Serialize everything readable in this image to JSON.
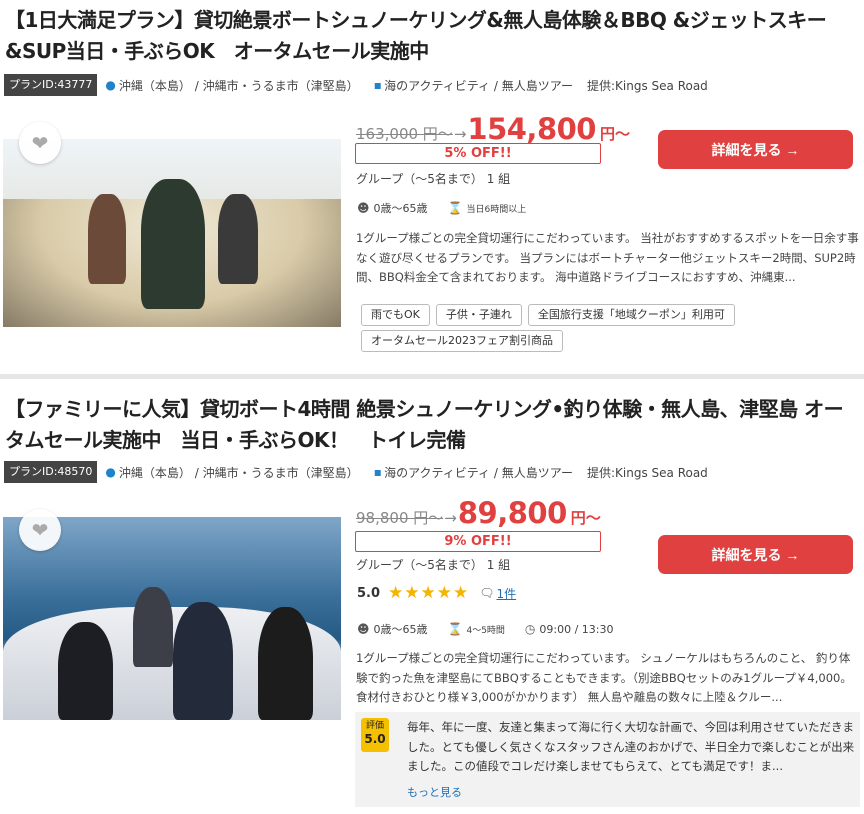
{
  "plans": [
    {
      "title": "【1日大満足プラン】貸切絶景ボートシュノーケリング&無人島体験＆BBQ &ジェットスキー&SUP当日・手ぶらOK　オータムセール実施中",
      "plan_id": "プランID:43777",
      "location": "沖縄（本島） / 沖縄市・うるま市（津堅島）",
      "category": "海のアクティビティ / 無人島ツアー",
      "provider": "提供:Kings Sea Road",
      "old_price": "163,000 円〜",
      "new_price": "154,800",
      "price_unit": "円〜",
      "discount": "5% OFF!!",
      "group": "グループ（〜5名まで） 1 組",
      "age": "0歳〜65歳",
      "duration": "当日6時間以上",
      "description": "1グループ様ごとの完全貸切運行にこだわっています。 当社がおすすめするスポットを一日余す事なく遊び尽くせるプランです。 当プランにはボートチャーター他ジェットスキー2時間、SUP2時間、BBQ料金全て含まれております。 海中道路ドライブコースにおすすめ、沖縄東...",
      "tags": [
        "雨でもOK",
        "子供・子連れ",
        "全国旅行支援「地域クーポン」利用可",
        "オータムセール2023フェア割引商品"
      ],
      "button": "詳細を見る →"
    },
    {
      "title": "【ファミリーに人気】貸切ボート4時間 絶景シュノーケリング•釣り体験・無人島、津堅島 オータムセール実施中　当日・手ぶらOK！　トイレ完備",
      "plan_id": "プランID:48570",
      "location": "沖縄（本島） / 沖縄市・うるま市（津堅島）",
      "category": "海のアクティビティ / 無人島ツアー",
      "provider": "提供:Kings Sea Road",
      "old_price": "98,800 円〜",
      "new_price": "89,800",
      "price_unit": "円〜",
      "discount": "9% OFF!!",
      "group": "グループ（〜5名まで） 1 組",
      "rating_score": "5.0",
      "stars": "★★★★★",
      "review_count": "1件",
      "age": "0歳〜65歳",
      "duration": "4〜5時間",
      "time": "09:00 / 13:30",
      "description": "1グループ様ごとの完全貸切運行にこだわっています。 シュノーケルはもちろんのこと、 釣り体験で釣った魚を津堅島にてBBQすることもできます。（別途BBQセットのみ1グループ￥4,000。食材付きおひとり様￥3,000がかかります） 無人島や離島の数々に上陸＆クルー...",
      "review_label": "評価",
      "review_score": "5.0",
      "review_text": "毎年、年に一度、友達と集まって海に行く大切な計画で、今回は利用させていただきました。とても優しく気さくなスタッフさん達のおかげで、半日全力で楽しむことが出来ました。この値段でコレだけ楽しませてもらえて、とても満足です！ま...",
      "more": "もっと見る",
      "button": "詳細を見る →"
    }
  ]
}
